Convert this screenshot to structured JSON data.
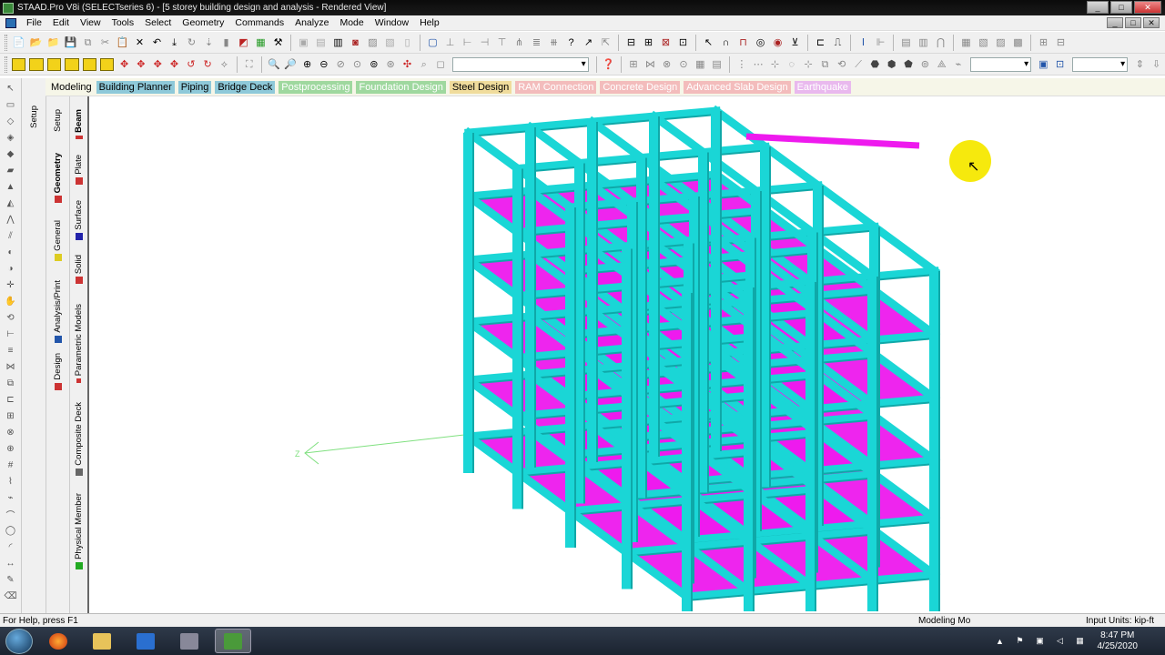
{
  "window": {
    "title": "STAAD.Pro V8i (SELECTseries 6) - [5 storey building design and analysis - Rendered View]",
    "buttons": [
      "_",
      "□",
      "✕"
    ],
    "child_buttons": [
      "_",
      "□",
      "✕"
    ]
  },
  "menu": [
    "File",
    "Edit",
    "View",
    "Tools",
    "Select",
    "Geometry",
    "Commands",
    "Analyze",
    "Mode",
    "Window",
    "Help"
  ],
  "modebar": {
    "label": "Modeling",
    "tabs": [
      {
        "label": "Building Planner",
        "bg": "#8ec9d9"
      },
      {
        "label": "Piping",
        "bg": "#8ec9d9"
      },
      {
        "label": "Bridge Deck",
        "bg": "#8ec9d9"
      },
      {
        "label": "Postprocessing",
        "bg": "#9fd89f"
      },
      {
        "label": "Foundation Design",
        "bg": "#9fd89f"
      },
      {
        "label": "Steel Design",
        "bg": "#f0dc9c"
      },
      {
        "label": "RAM Connection",
        "bg": "#f3bcbc"
      },
      {
        "label": "Concrete Design",
        "bg": "#f3bcbc"
      },
      {
        "label": "Advanced Slab Design",
        "bg": "#f3bcbc"
      },
      {
        "label": "Earthquake",
        "bg": "#e9b9ee"
      }
    ]
  },
  "left_tabs_1": [
    "Setup",
    "Geometry",
    "General",
    "Analysis/Print",
    "Design"
  ],
  "left_tabs_2": [
    "Beam",
    "Plate",
    "Surface",
    "Solid",
    "Parametric Models",
    "Composite Deck",
    "Physical Member"
  ],
  "viewport": {
    "axis_label": "Z",
    "colors": {
      "member": "#1ad6d6",
      "member_dark": "#0fa8a8",
      "plate": "#ee1aee",
      "plate_line": "#9a129a",
      "highlight": "#f5e800"
    }
  },
  "status": {
    "help": "For Help, press F1",
    "mode": "Modeling Mo",
    "units": "Input Units:  kip-ft"
  },
  "taskbar": {
    "time": "8:47 PM",
    "date": "4/25/2020"
  }
}
